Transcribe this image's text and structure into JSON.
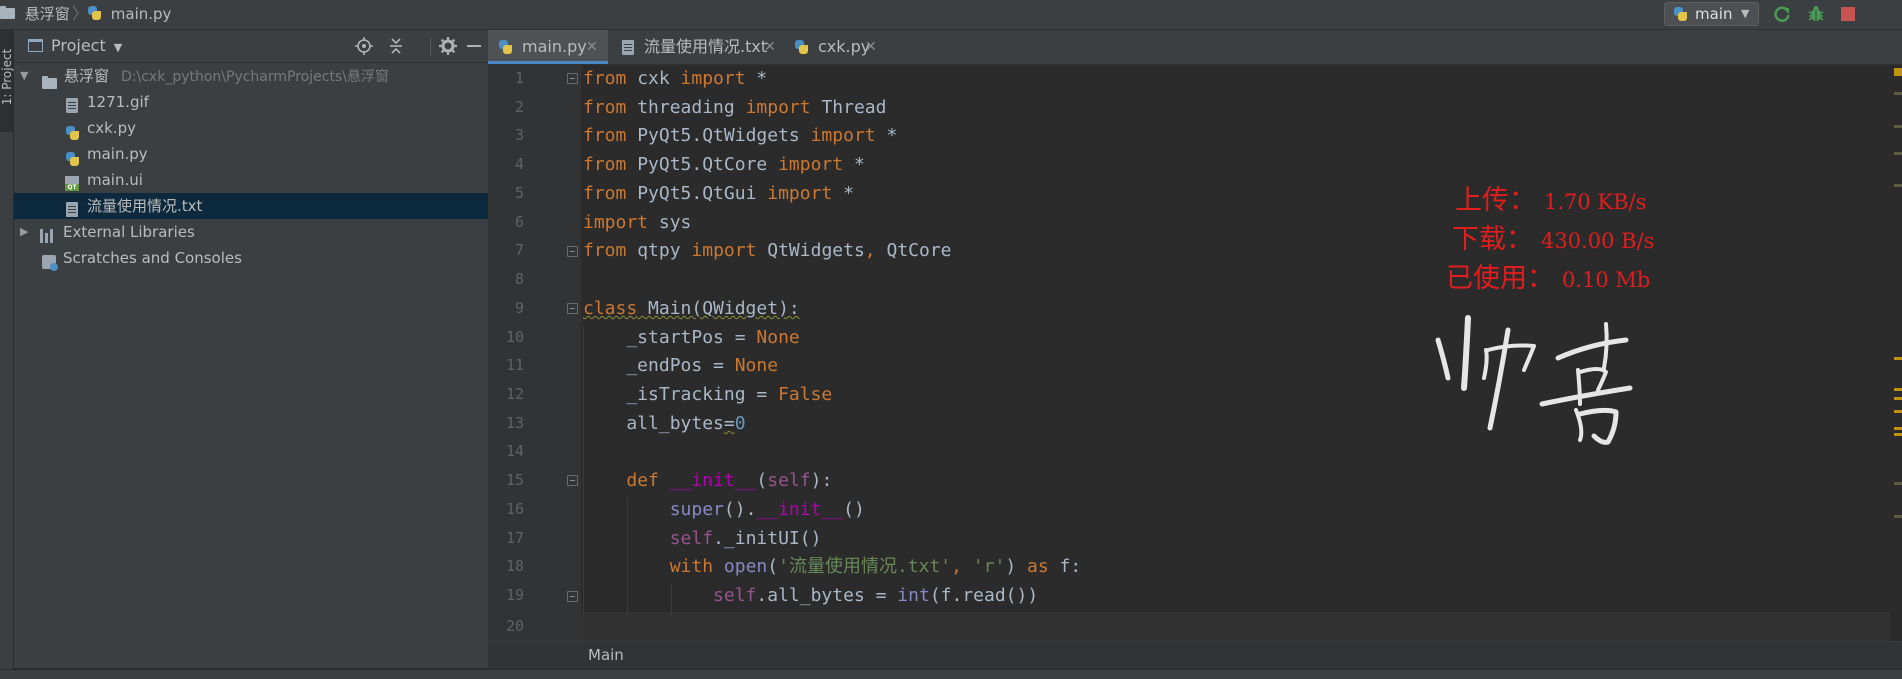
{
  "navbar": {
    "project_name": "悬浮窗",
    "current_file": "main.py",
    "run_config": "main"
  },
  "colors": {
    "run_green": "#499c54",
    "debug_green": "#499c54",
    "stop_red": "#c75450",
    "overlay_red": "#e11d1d",
    "accent_blue": "#4a88c7"
  },
  "sidebar_strip": {
    "project_tab": "1: Project"
  },
  "project_panel": {
    "title": "Project",
    "root": {
      "name": "悬浮窗",
      "path": "D:\\cxk_python\\PycharmProjects\\悬浮窗"
    },
    "files": [
      {
        "name": "1271.gif",
        "icon": "gif-file-icon"
      },
      {
        "name": "cxk.py",
        "icon": "python-file-icon"
      },
      {
        "name": "main.py",
        "icon": "python-file-icon"
      },
      {
        "name": "main.ui",
        "icon": "qt-ui-file-icon"
      },
      {
        "name": "流量使用情况.txt",
        "icon": "text-file-icon"
      }
    ],
    "external_libraries": "External Libraries",
    "scratches": "Scratches and Consoles"
  },
  "editor": {
    "tabs": [
      {
        "label": "main.py",
        "icon": "python-file-icon"
      },
      {
        "label": "流量使用情况.txt",
        "icon": "text-file-icon"
      },
      {
        "label": "cxk.py",
        "icon": "python-file-icon"
      }
    ],
    "line_numbers": [
      "1",
      "2",
      "3",
      "4",
      "5",
      "6",
      "7",
      "8",
      "9",
      "10",
      "11",
      "12",
      "13",
      "14",
      "15",
      "16",
      "17",
      "18",
      "19",
      "20"
    ],
    "breadcrumb": "Main"
  },
  "overlay": {
    "upload_label": "上传：",
    "upload_value": "1.70 KB/s",
    "download_label": "下载：",
    "download_value": "430.00 B/s",
    "used_label": "已使用：",
    "used_value": "0.10 Mb",
    "signature": "帅哥"
  }
}
